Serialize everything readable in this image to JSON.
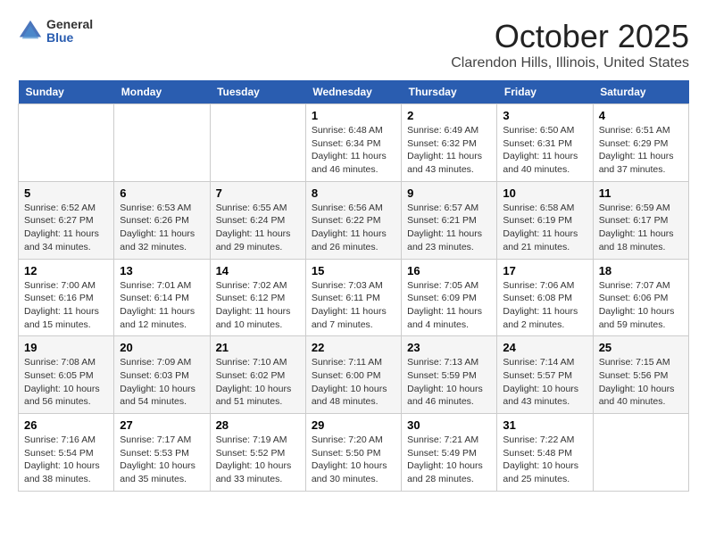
{
  "header": {
    "logo_general": "General",
    "logo_blue": "Blue",
    "title": "October 2025",
    "location": "Clarendon Hills, Illinois, United States"
  },
  "days": [
    "Sunday",
    "Monday",
    "Tuesday",
    "Wednesday",
    "Thursday",
    "Friday",
    "Saturday"
  ],
  "weeks": [
    [
      {
        "date": "",
        "sunrise": "",
        "sunset": "",
        "daylight": ""
      },
      {
        "date": "",
        "sunrise": "",
        "sunset": "",
        "daylight": ""
      },
      {
        "date": "",
        "sunrise": "",
        "sunset": "",
        "daylight": ""
      },
      {
        "date": "1",
        "sunrise": "Sunrise: 6:48 AM",
        "sunset": "Sunset: 6:34 PM",
        "daylight": "Daylight: 11 hours and 46 minutes."
      },
      {
        "date": "2",
        "sunrise": "Sunrise: 6:49 AM",
        "sunset": "Sunset: 6:32 PM",
        "daylight": "Daylight: 11 hours and 43 minutes."
      },
      {
        "date": "3",
        "sunrise": "Sunrise: 6:50 AM",
        "sunset": "Sunset: 6:31 PM",
        "daylight": "Daylight: 11 hours and 40 minutes."
      },
      {
        "date": "4",
        "sunrise": "Sunrise: 6:51 AM",
        "sunset": "Sunset: 6:29 PM",
        "daylight": "Daylight: 11 hours and 37 minutes."
      }
    ],
    [
      {
        "date": "5",
        "sunrise": "Sunrise: 6:52 AM",
        "sunset": "Sunset: 6:27 PM",
        "daylight": "Daylight: 11 hours and 34 minutes."
      },
      {
        "date": "6",
        "sunrise": "Sunrise: 6:53 AM",
        "sunset": "Sunset: 6:26 PM",
        "daylight": "Daylight: 11 hours and 32 minutes."
      },
      {
        "date": "7",
        "sunrise": "Sunrise: 6:55 AM",
        "sunset": "Sunset: 6:24 PM",
        "daylight": "Daylight: 11 hours and 29 minutes."
      },
      {
        "date": "8",
        "sunrise": "Sunrise: 6:56 AM",
        "sunset": "Sunset: 6:22 PM",
        "daylight": "Daylight: 11 hours and 26 minutes."
      },
      {
        "date": "9",
        "sunrise": "Sunrise: 6:57 AM",
        "sunset": "Sunset: 6:21 PM",
        "daylight": "Daylight: 11 hours and 23 minutes."
      },
      {
        "date": "10",
        "sunrise": "Sunrise: 6:58 AM",
        "sunset": "Sunset: 6:19 PM",
        "daylight": "Daylight: 11 hours and 21 minutes."
      },
      {
        "date": "11",
        "sunrise": "Sunrise: 6:59 AM",
        "sunset": "Sunset: 6:17 PM",
        "daylight": "Daylight: 11 hours and 18 minutes."
      }
    ],
    [
      {
        "date": "12",
        "sunrise": "Sunrise: 7:00 AM",
        "sunset": "Sunset: 6:16 PM",
        "daylight": "Daylight: 11 hours and 15 minutes."
      },
      {
        "date": "13",
        "sunrise": "Sunrise: 7:01 AM",
        "sunset": "Sunset: 6:14 PM",
        "daylight": "Daylight: 11 hours and 12 minutes."
      },
      {
        "date": "14",
        "sunrise": "Sunrise: 7:02 AM",
        "sunset": "Sunset: 6:12 PM",
        "daylight": "Daylight: 11 hours and 10 minutes."
      },
      {
        "date": "15",
        "sunrise": "Sunrise: 7:03 AM",
        "sunset": "Sunset: 6:11 PM",
        "daylight": "Daylight: 11 hours and 7 minutes."
      },
      {
        "date": "16",
        "sunrise": "Sunrise: 7:05 AM",
        "sunset": "Sunset: 6:09 PM",
        "daylight": "Daylight: 11 hours and 4 minutes."
      },
      {
        "date": "17",
        "sunrise": "Sunrise: 7:06 AM",
        "sunset": "Sunset: 6:08 PM",
        "daylight": "Daylight: 11 hours and 2 minutes."
      },
      {
        "date": "18",
        "sunrise": "Sunrise: 7:07 AM",
        "sunset": "Sunset: 6:06 PM",
        "daylight": "Daylight: 10 hours and 59 minutes."
      }
    ],
    [
      {
        "date": "19",
        "sunrise": "Sunrise: 7:08 AM",
        "sunset": "Sunset: 6:05 PM",
        "daylight": "Daylight: 10 hours and 56 minutes."
      },
      {
        "date": "20",
        "sunrise": "Sunrise: 7:09 AM",
        "sunset": "Sunset: 6:03 PM",
        "daylight": "Daylight: 10 hours and 54 minutes."
      },
      {
        "date": "21",
        "sunrise": "Sunrise: 7:10 AM",
        "sunset": "Sunset: 6:02 PM",
        "daylight": "Daylight: 10 hours and 51 minutes."
      },
      {
        "date": "22",
        "sunrise": "Sunrise: 7:11 AM",
        "sunset": "Sunset: 6:00 PM",
        "daylight": "Daylight: 10 hours and 48 minutes."
      },
      {
        "date": "23",
        "sunrise": "Sunrise: 7:13 AM",
        "sunset": "Sunset: 5:59 PM",
        "daylight": "Daylight: 10 hours and 46 minutes."
      },
      {
        "date": "24",
        "sunrise": "Sunrise: 7:14 AM",
        "sunset": "Sunset: 5:57 PM",
        "daylight": "Daylight: 10 hours and 43 minutes."
      },
      {
        "date": "25",
        "sunrise": "Sunrise: 7:15 AM",
        "sunset": "Sunset: 5:56 PM",
        "daylight": "Daylight: 10 hours and 40 minutes."
      }
    ],
    [
      {
        "date": "26",
        "sunrise": "Sunrise: 7:16 AM",
        "sunset": "Sunset: 5:54 PM",
        "daylight": "Daylight: 10 hours and 38 minutes."
      },
      {
        "date": "27",
        "sunrise": "Sunrise: 7:17 AM",
        "sunset": "Sunset: 5:53 PM",
        "daylight": "Daylight: 10 hours and 35 minutes."
      },
      {
        "date": "28",
        "sunrise": "Sunrise: 7:19 AM",
        "sunset": "Sunset: 5:52 PM",
        "daylight": "Daylight: 10 hours and 33 minutes."
      },
      {
        "date": "29",
        "sunrise": "Sunrise: 7:20 AM",
        "sunset": "Sunset: 5:50 PM",
        "daylight": "Daylight: 10 hours and 30 minutes."
      },
      {
        "date": "30",
        "sunrise": "Sunrise: 7:21 AM",
        "sunset": "Sunset: 5:49 PM",
        "daylight": "Daylight: 10 hours and 28 minutes."
      },
      {
        "date": "31",
        "sunrise": "Sunrise: 7:22 AM",
        "sunset": "Sunset: 5:48 PM",
        "daylight": "Daylight: 10 hours and 25 minutes."
      },
      {
        "date": "",
        "sunrise": "",
        "sunset": "",
        "daylight": ""
      }
    ]
  ]
}
